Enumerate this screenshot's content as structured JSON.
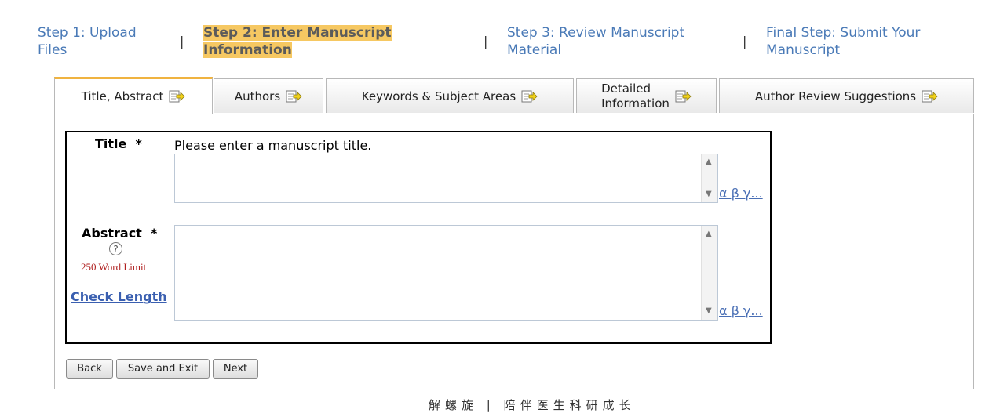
{
  "steps": [
    {
      "line1": "Step 1: Upload",
      "line2": "Files",
      "active": false
    },
    {
      "line1": "Step 2: Enter Manuscript",
      "line2": "Information",
      "active": true
    },
    {
      "line1": "Step 3: Review Manuscript",
      "line2": "Material",
      "active": false
    },
    {
      "line1": "Final Step: Submit Your",
      "line2": "Manuscript",
      "active": false
    }
  ],
  "separator": "|",
  "tabs": [
    {
      "label": "Title, Abstract",
      "icon": "edit-note-icon",
      "active": true
    },
    {
      "label": "Authors",
      "icon": "edit-note-icon",
      "active": false
    },
    {
      "label": "Keywords & Subject Areas",
      "icon": "edit-note-icon",
      "active": false
    },
    {
      "line1": "Detailed",
      "line2": "Information",
      "icon": "edit-note-icon",
      "active": false
    },
    {
      "label": "Author Review Suggestions",
      "icon": "edit-note-icon",
      "active": false
    }
  ],
  "form": {
    "title_label": "Title",
    "required_marker": "*",
    "title_hint": "Please enter a manuscript title.",
    "title_value": "",
    "special_chars_link": "α β γ...",
    "abstract_label": "Abstract",
    "help_icon": "?",
    "word_limit": "250 Word Limit",
    "check_length": "Check Length",
    "abstract_value": ""
  },
  "buttons": {
    "back": "Back",
    "save_exit": "Save and Exit",
    "next": "Next"
  },
  "footer": "解螺旋 | 陪伴医生科研成长",
  "colors": {
    "step_link": "#4a7ab7",
    "step_active_highlight": "#f6c862",
    "active_tab_border": "#f0b340",
    "word_limit": "#b02020"
  }
}
